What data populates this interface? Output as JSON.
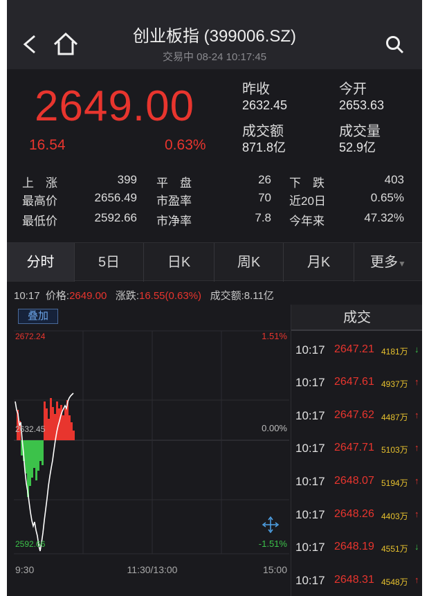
{
  "header": {
    "title": "创业板指 (399006.SZ)",
    "status": "交易中 08-24 10:17:45"
  },
  "quote": {
    "price": "2649.00",
    "change": "16.54",
    "change_pct": "0.63%",
    "prev_close_label": "昨收",
    "prev_close": "2632.45",
    "open_label": "今开",
    "open": "2653.63",
    "turnover_label": "成交额",
    "turnover": "871.8亿",
    "volume_label": "成交量",
    "volume": "52.9亿"
  },
  "stats": [
    {
      "l1": "上　涨",
      "v1": "399",
      "l2": "平　盘",
      "v2": "26",
      "l3": "下　跌",
      "v3": "403"
    },
    {
      "l1": "最高价",
      "v1": "2656.49",
      "l2": "市盈率",
      "v2": "70",
      "l3": "近20日",
      "v3": "0.65%"
    },
    {
      "l1": "最低价",
      "v1": "2592.66",
      "l2": "市净率",
      "v2": "7.8",
      "l3": "今年来",
      "v3": "47.32%"
    }
  ],
  "tabs": [
    "分时",
    "5日",
    "日K",
    "周K",
    "月K",
    "更多"
  ],
  "infoline": {
    "time": "10:17",
    "price_label": "价格:",
    "price": "2649.00",
    "change_label": "涨跌:",
    "change": "16.55(0.63%)",
    "turnover_label": "成交额:",
    "turnover": "8.11亿"
  },
  "chart": {
    "overlay_label": "叠加",
    "y_top": "2672.24",
    "y_mid": "2632.45",
    "y_bottom": "2592.66",
    "pct_top": "1.51%",
    "pct_mid": "0.00%",
    "pct_bottom": "-1.51%",
    "t_start": "9:30",
    "t_mid": "11:30/13:00",
    "t_end": "15:00",
    "colors": {
      "up": "#e8352e",
      "down": "#3cc24a",
      "line": "#ffffff",
      "grid": "#2c2c31"
    }
  },
  "trades": {
    "header": "成交",
    "rows": [
      {
        "time": "10:17",
        "price": "2647.21",
        "vol": "4181万",
        "dir": "down"
      },
      {
        "time": "10:17",
        "price": "2647.61",
        "vol": "4937万",
        "dir": "up"
      },
      {
        "time": "10:17",
        "price": "2647.62",
        "vol": "4487万",
        "dir": "up"
      },
      {
        "time": "10:17",
        "price": "2647.71",
        "vol": "5103万",
        "dir": "up"
      },
      {
        "time": "10:17",
        "price": "2648.07",
        "vol": "5194万",
        "dir": "up"
      },
      {
        "time": "10:17",
        "price": "2648.26",
        "vol": "4403万",
        "dir": "up"
      },
      {
        "time": "10:17",
        "price": "2648.19",
        "vol": "4551万",
        "dir": "down"
      },
      {
        "time": "10:17",
        "price": "2648.31",
        "vol": "4548万",
        "dir": "up"
      }
    ]
  }
}
